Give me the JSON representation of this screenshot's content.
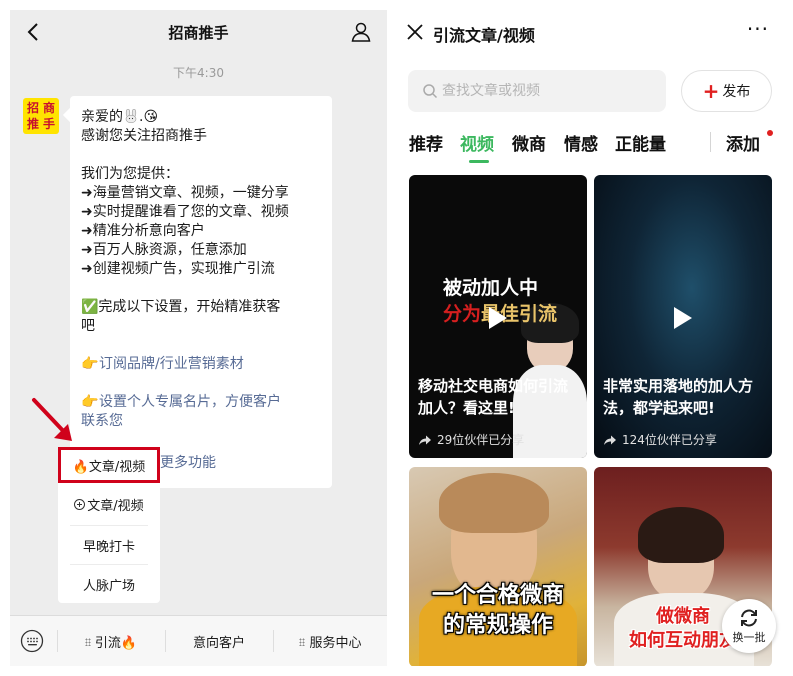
{
  "left": {
    "header": {
      "title": "招商推手"
    },
    "time": "下午4:30",
    "avatar_chars": [
      "招",
      "商",
      "推",
      "手"
    ],
    "message": {
      "greeting_prefix": "亲爱的",
      "greeting_suffix": ".😘",
      "thanks": "感谢您关注招商推手",
      "offer_title": "我们为您提供：",
      "features": [
        "➜海量营销文章、视频，一键分享",
        "➜实时提醒谁看了您的文章、视频",
        "➜精准分析意向客户",
        "➜百万人脉资源，任意添加",
        "➜创建视频广告，实现推广引流"
      ],
      "setup_line1": "✅完成以下设置，开始精准获客",
      "setup_line2": "吧",
      "link1_icon": "👉",
      "link1": "订阅品牌/行业营销素材",
      "link2_icon": "👉",
      "link2_line1": "设置个人专属名片，方便客户",
      "link2_line2": "联系您",
      "link3_partial": "更多功能"
    },
    "popup_menu": {
      "highlighted": "🔥文章/视频",
      "items": [
        "文章/视频",
        "早晚打卡",
        "人脉广场"
      ]
    },
    "tabbar": {
      "items": [
        "引流🔥",
        "意向客户",
        "服务中心"
      ]
    }
  },
  "right": {
    "header": {
      "title": "引流文章/视频",
      "more": "···"
    },
    "search": {
      "placeholder": "查找文章或视频"
    },
    "publish_label": "发布",
    "tabs": [
      "推荐",
      "视频",
      "微商",
      "情感",
      "正能量"
    ],
    "active_tab": 1,
    "add_label": "添加",
    "cards": [
      {
        "title": "移动社交电商如何引流加人？看这里!",
        "share": "29位伙伴已分享",
        "thumb_text_top": "被动加人中",
        "thumb_text_bottom": "分为",
        "thumb_text_bottom2": "最佳引流"
      },
      {
        "title": "非常实用落地的加人方法，都学起来吧!",
        "share": "124位伙伴已分享"
      },
      {
        "overlay_line1": "一个合格微商",
        "overlay_line2": "的常规操作"
      },
      {
        "overlay_line1": "做微商",
        "overlay_line2": "如何互动朋友"
      }
    ],
    "refresh_label": "换一批"
  },
  "colors": {
    "accent_green": "#3cb85f",
    "highlight_red": "#d0021b",
    "link_blue": "#576b95",
    "chat_bg": "#ededed"
  }
}
